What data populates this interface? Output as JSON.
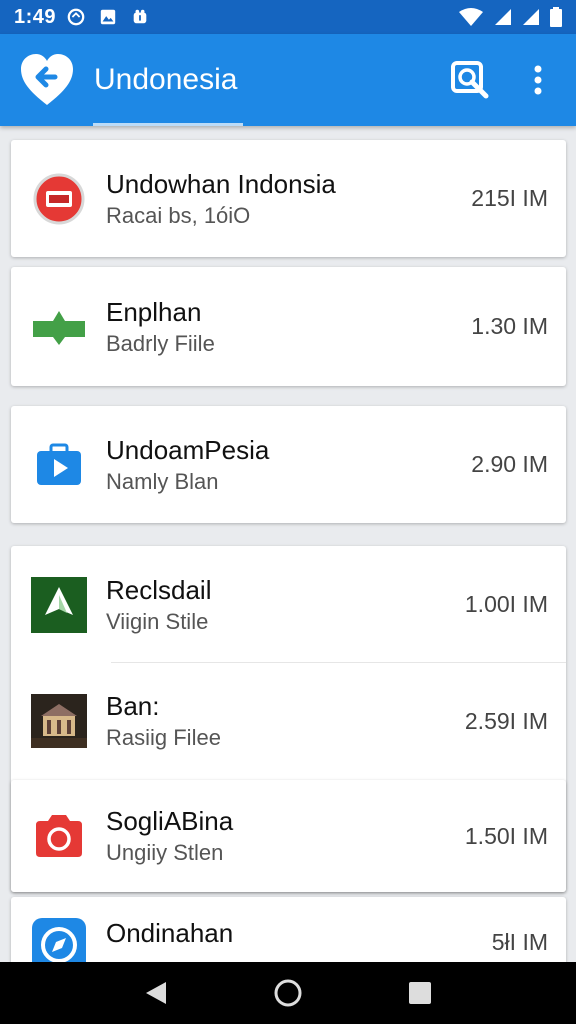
{
  "status_bar": {
    "time": "1:49",
    "left_icons": [
      "sync-icon",
      "image-icon",
      "bug-icon"
    ],
    "right_icons": [
      "wifi-icon",
      "signal-icon",
      "signal-icon",
      "battery-icon"
    ]
  },
  "app_bar": {
    "title": "Undonesia",
    "back_icon": "back-heart-icon",
    "actions": [
      "search-icon",
      "more-vert-icon"
    ],
    "color": "#1e88e5",
    "status_color": "#1565c0"
  },
  "items": [
    {
      "title": "Undowhan Indonsia",
      "subtitle": "Racai bs, 1óiO",
      "size": "215I IM",
      "icon": "red-circle-app-icon"
    },
    {
      "title": "Enplhan",
      "subtitle": "Badrly Fiile",
      "size": "1.30 IM",
      "icon": "green-arrow-app-icon"
    },
    {
      "title": "UndoamPesia",
      "subtitle": "Namly Blan",
      "size": "2.90 IM",
      "icon": "blue-play-bag-icon"
    },
    {
      "title": "Reclsdail",
      "subtitle": "Viigin Stile",
      "size": "1.00I IM",
      "icon": "green-tree-app-icon"
    },
    {
      "title": "Ban:",
      "subtitle": "Rasiig Filee",
      "size": "2.59I IM",
      "icon": "building-photo-icon"
    },
    {
      "title": "SoglіABina",
      "subtitle": "Ungiiy Stlen",
      "size": "1.50I IM",
      "icon": "red-camera-app-icon"
    },
    {
      "title": "Ondinahan",
      "subtitle": "",
      "size": "5łI IM",
      "icon": "blue-compass-app-icon"
    }
  ],
  "nav_bar": {
    "buttons": [
      "back-triangle-icon",
      "home-circle-icon",
      "recents-square-icon"
    ]
  }
}
